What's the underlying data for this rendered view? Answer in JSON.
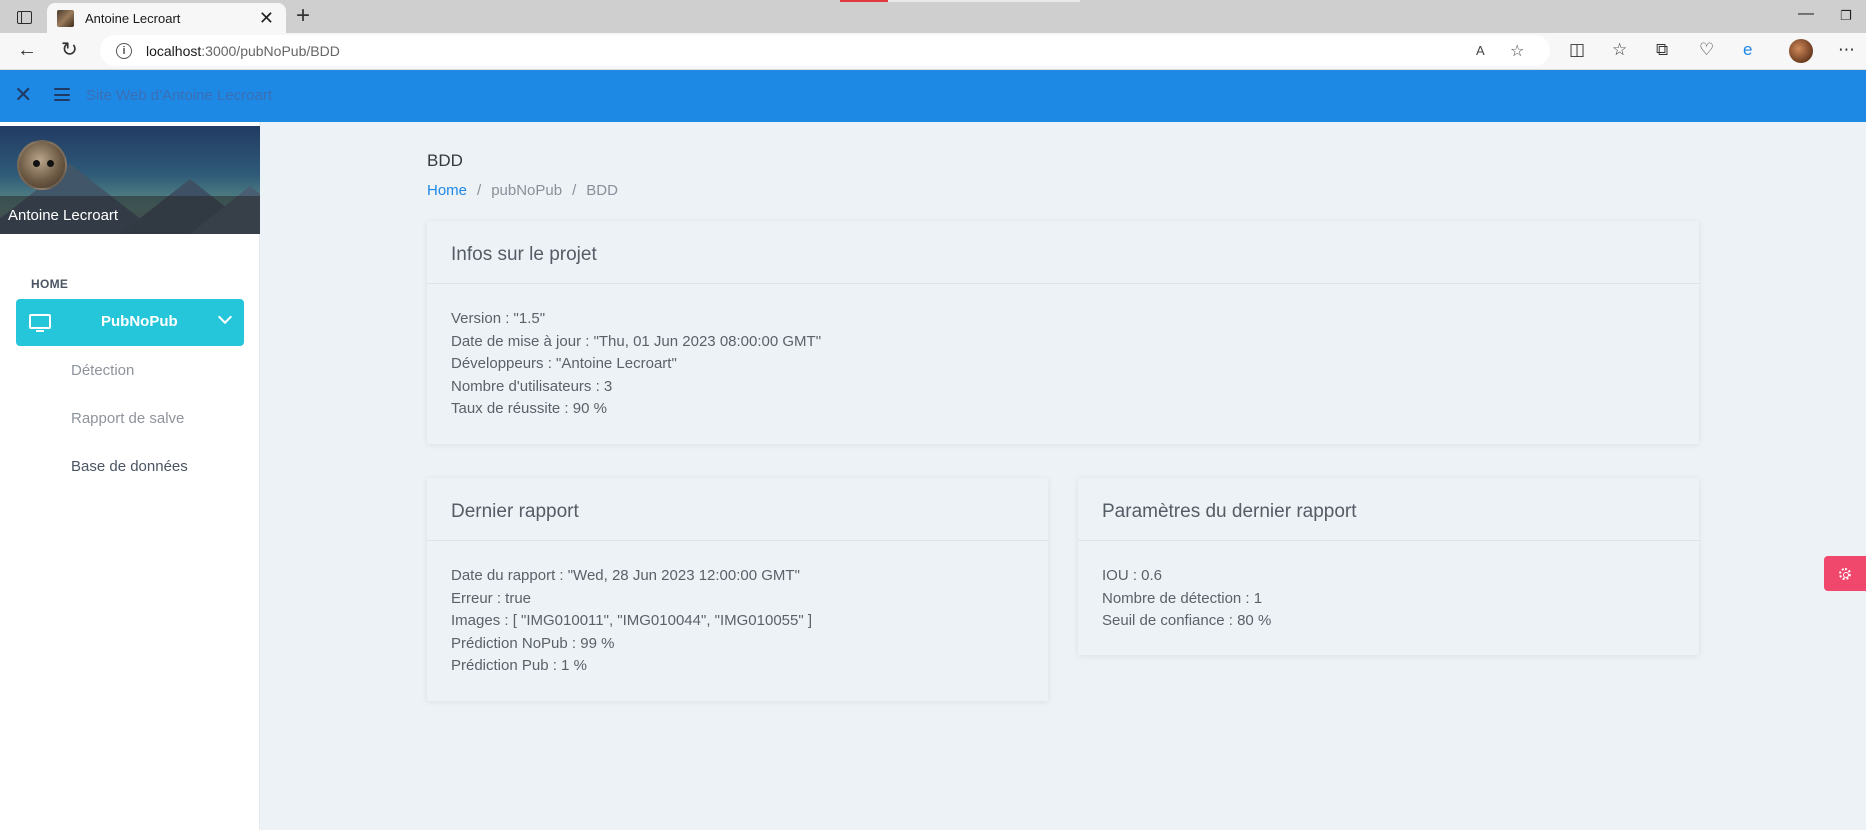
{
  "browser": {
    "tab_title": "Antoine Lecroart",
    "url_host": "localhost",
    "url_rest": ":3000/pubNoPub/BDD"
  },
  "app": {
    "site_title": "Site Web d'Antoine Lecroart"
  },
  "sidebar": {
    "user_name": "Antoine Lecroart",
    "nav_header": "HOME",
    "active_item": "PubNoPub",
    "sub_items": [
      "Détection",
      "Rapport de salve",
      "Base de données"
    ]
  },
  "page": {
    "title": "BDD",
    "breadcrumb": [
      "Home",
      "pubNoPub",
      "BDD"
    ]
  },
  "cards": {
    "project": {
      "title": "Infos sur le projet",
      "lines": [
        "Version : \"1.5\"",
        "Date de mise à jour : \"Thu, 01 Jun 2023 08:00:00 GMT\"",
        "Développeurs : \"Antoine Lecroart\"",
        "Nombre d'utilisateurs : 3",
        "Taux de réussite : 90 %"
      ]
    },
    "report": {
      "title": "Dernier rapport",
      "lines": [
        "Date du rapport : \"Wed, 28 Jun 2023 12:00:00 GMT\"",
        "Erreur : true",
        "Images : [ \"IMG010011\", \"IMG010044\", \"IMG010055\" ]",
        "Prédiction NoPub : 99 %",
        "Prédiction Pub : 1 %"
      ]
    },
    "params": {
      "title": "Paramètres du dernier rapport",
      "lines": [
        "IOU : 0.6",
        "Nombre de détection : 1",
        "Seuil de confiance : 80 %"
      ]
    }
  },
  "colors": {
    "appbar": "#1e88e5",
    "active_nav": "#26c6da",
    "settings_button": "#f0476d",
    "link": "#1e88e5"
  }
}
